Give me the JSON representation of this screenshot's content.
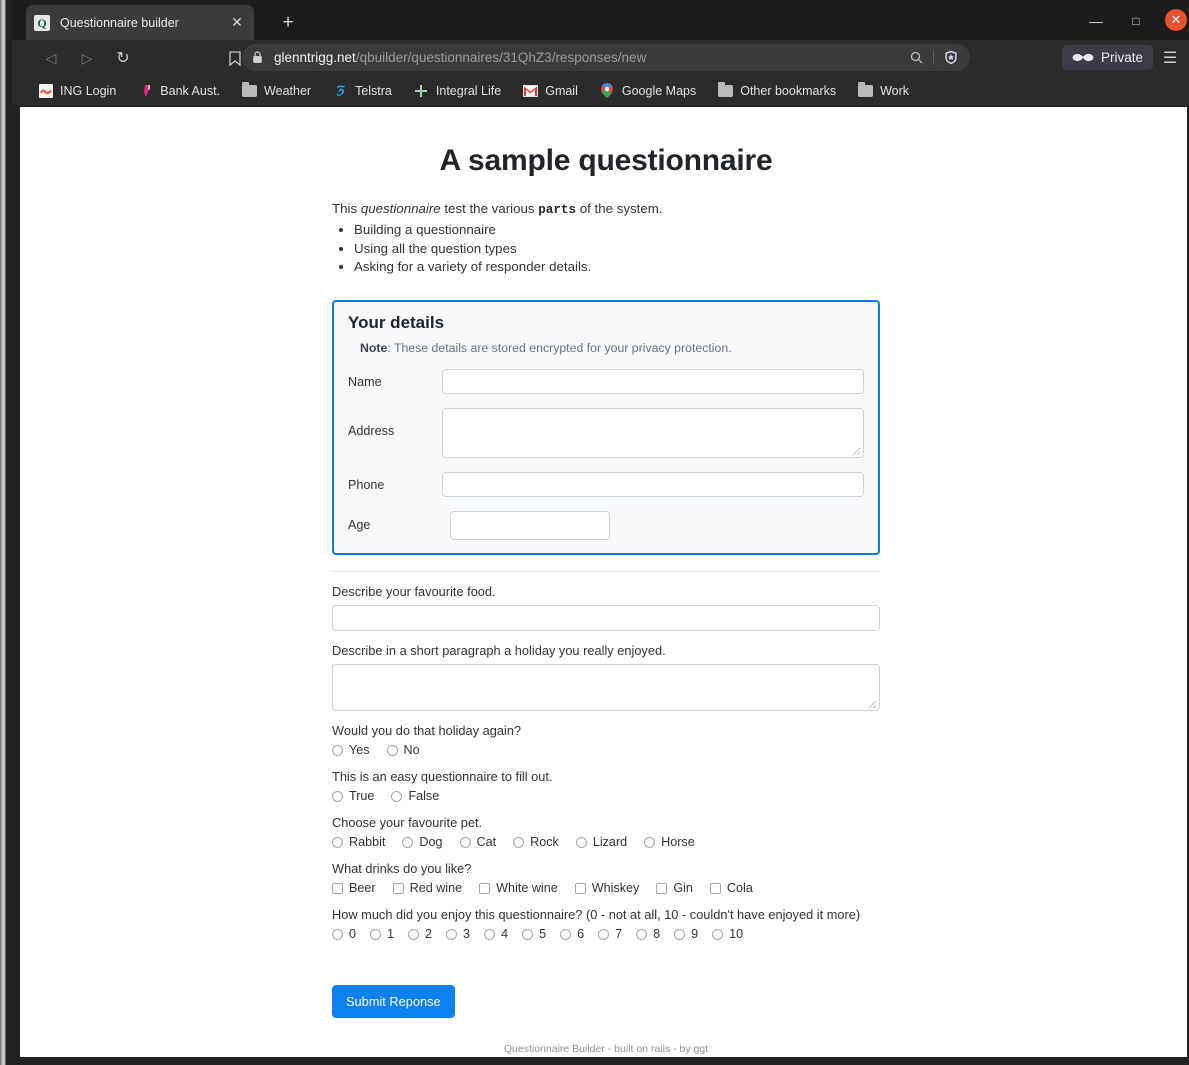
{
  "browser": {
    "tab": {
      "title": "Questionnaire builder",
      "favicon_letter": "Q",
      "close_label": "✕"
    },
    "newtab_label": "+",
    "window_controls": {
      "minimize": "—",
      "maximize": "□",
      "close": "✕"
    },
    "nav": {
      "back": "◁",
      "forward": "▷",
      "reload": "↻",
      "bookmark": "☐"
    },
    "omnibox": {
      "lock": "🔒",
      "url_domain": "glenntrigg.net",
      "url_path": "/qbuilder/questionnaires/31QhZ3/responses/new",
      "search_icon": "⌕",
      "shield_icon": "brave-shield"
    },
    "private_label": "Private",
    "menu_label": "☰",
    "bookmarks": [
      {
        "label": "ING Login",
        "icon": "ing-icon",
        "color": "#e8603c"
      },
      {
        "label": "Bank Aust.",
        "icon": "bank-australia-icon",
        "color": "#e6237f"
      },
      {
        "label": "Weather",
        "icon": "folder-icon",
        "color": "#b9b9b9"
      },
      {
        "label": "Telstra",
        "icon": "telstra-icon",
        "color": "#1aa5e0"
      },
      {
        "label": "Integral Life",
        "icon": "integral-life-icon",
        "color": "#9fd8a8"
      },
      {
        "label": "Gmail",
        "icon": "gmail-icon",
        "color": "#e23b2e"
      },
      {
        "label": "Google Maps",
        "icon": "google-maps-icon",
        "color": "#34a853"
      },
      {
        "label": "Other bookmarks",
        "icon": "folder-icon",
        "color": "#b9b9b9"
      },
      {
        "label": "Work",
        "icon": "folder-icon",
        "color": "#b9b9b9"
      }
    ]
  },
  "page": {
    "title": "A sample questionnaire",
    "intro": {
      "before_italic": "This ",
      "italic": "questionnaire",
      "middle": " test the various ",
      "code": "parts",
      "after": " of the system."
    },
    "bullets": [
      "Building a questionnaire",
      "Using all the question types",
      "Asking for a variety of responder details."
    ],
    "details_fieldset": {
      "title": "Your details",
      "note_bold": "Note",
      "note_text": ": These details are stored encrypted for your privacy protection.",
      "fields": [
        {
          "label": "Name",
          "type": "text",
          "value": ""
        },
        {
          "label": "Address",
          "type": "textarea",
          "value": ""
        },
        {
          "label": "Phone",
          "type": "text",
          "value": ""
        },
        {
          "label": "Age",
          "type": "number",
          "value": ""
        }
      ]
    },
    "questions": [
      {
        "id": "favourite-food",
        "label": "Describe your favourite food.",
        "type": "text",
        "value": ""
      },
      {
        "id": "holiday-paragraph",
        "label": "Describe in a short paragraph a holiday you really enjoyed.",
        "type": "textarea",
        "value": ""
      },
      {
        "id": "holiday-again",
        "label": "Would you do that holiday again?",
        "type": "radio",
        "options": [
          "Yes",
          "No"
        ],
        "selected": null
      },
      {
        "id": "easy-questionnaire",
        "label": "This is an easy questionnaire to fill out.",
        "type": "radio",
        "options": [
          "True",
          "False"
        ],
        "selected": null
      },
      {
        "id": "favourite-pet",
        "label": "Choose your favourite pet.",
        "type": "radio",
        "options": [
          "Rabbit",
          "Dog",
          "Cat",
          "Rock",
          "Lizard",
          "Horse"
        ],
        "selected": null
      },
      {
        "id": "drinks",
        "label": "What drinks do you like?",
        "type": "checkbox",
        "options": [
          "Beer",
          "Red wine",
          "White wine",
          "Whiskey",
          "Gin",
          "Cola"
        ],
        "selected": []
      },
      {
        "id": "enjoyment-rating",
        "label": "How much did you enjoy this questionnaire? (0 - not at all, 10 - couldn't have enjoyed it more)",
        "type": "radio",
        "options": [
          "0",
          "1",
          "2",
          "3",
          "4",
          "5",
          "6",
          "7",
          "8",
          "9",
          "10"
        ],
        "selected": null
      }
    ],
    "submit_label": "Submit Reponse",
    "footer": "Questionnaire Builder - built on rails - by ggt",
    "accent_color": "#0d80f2",
    "fieldset_border_color": "#0d7cdb"
  }
}
